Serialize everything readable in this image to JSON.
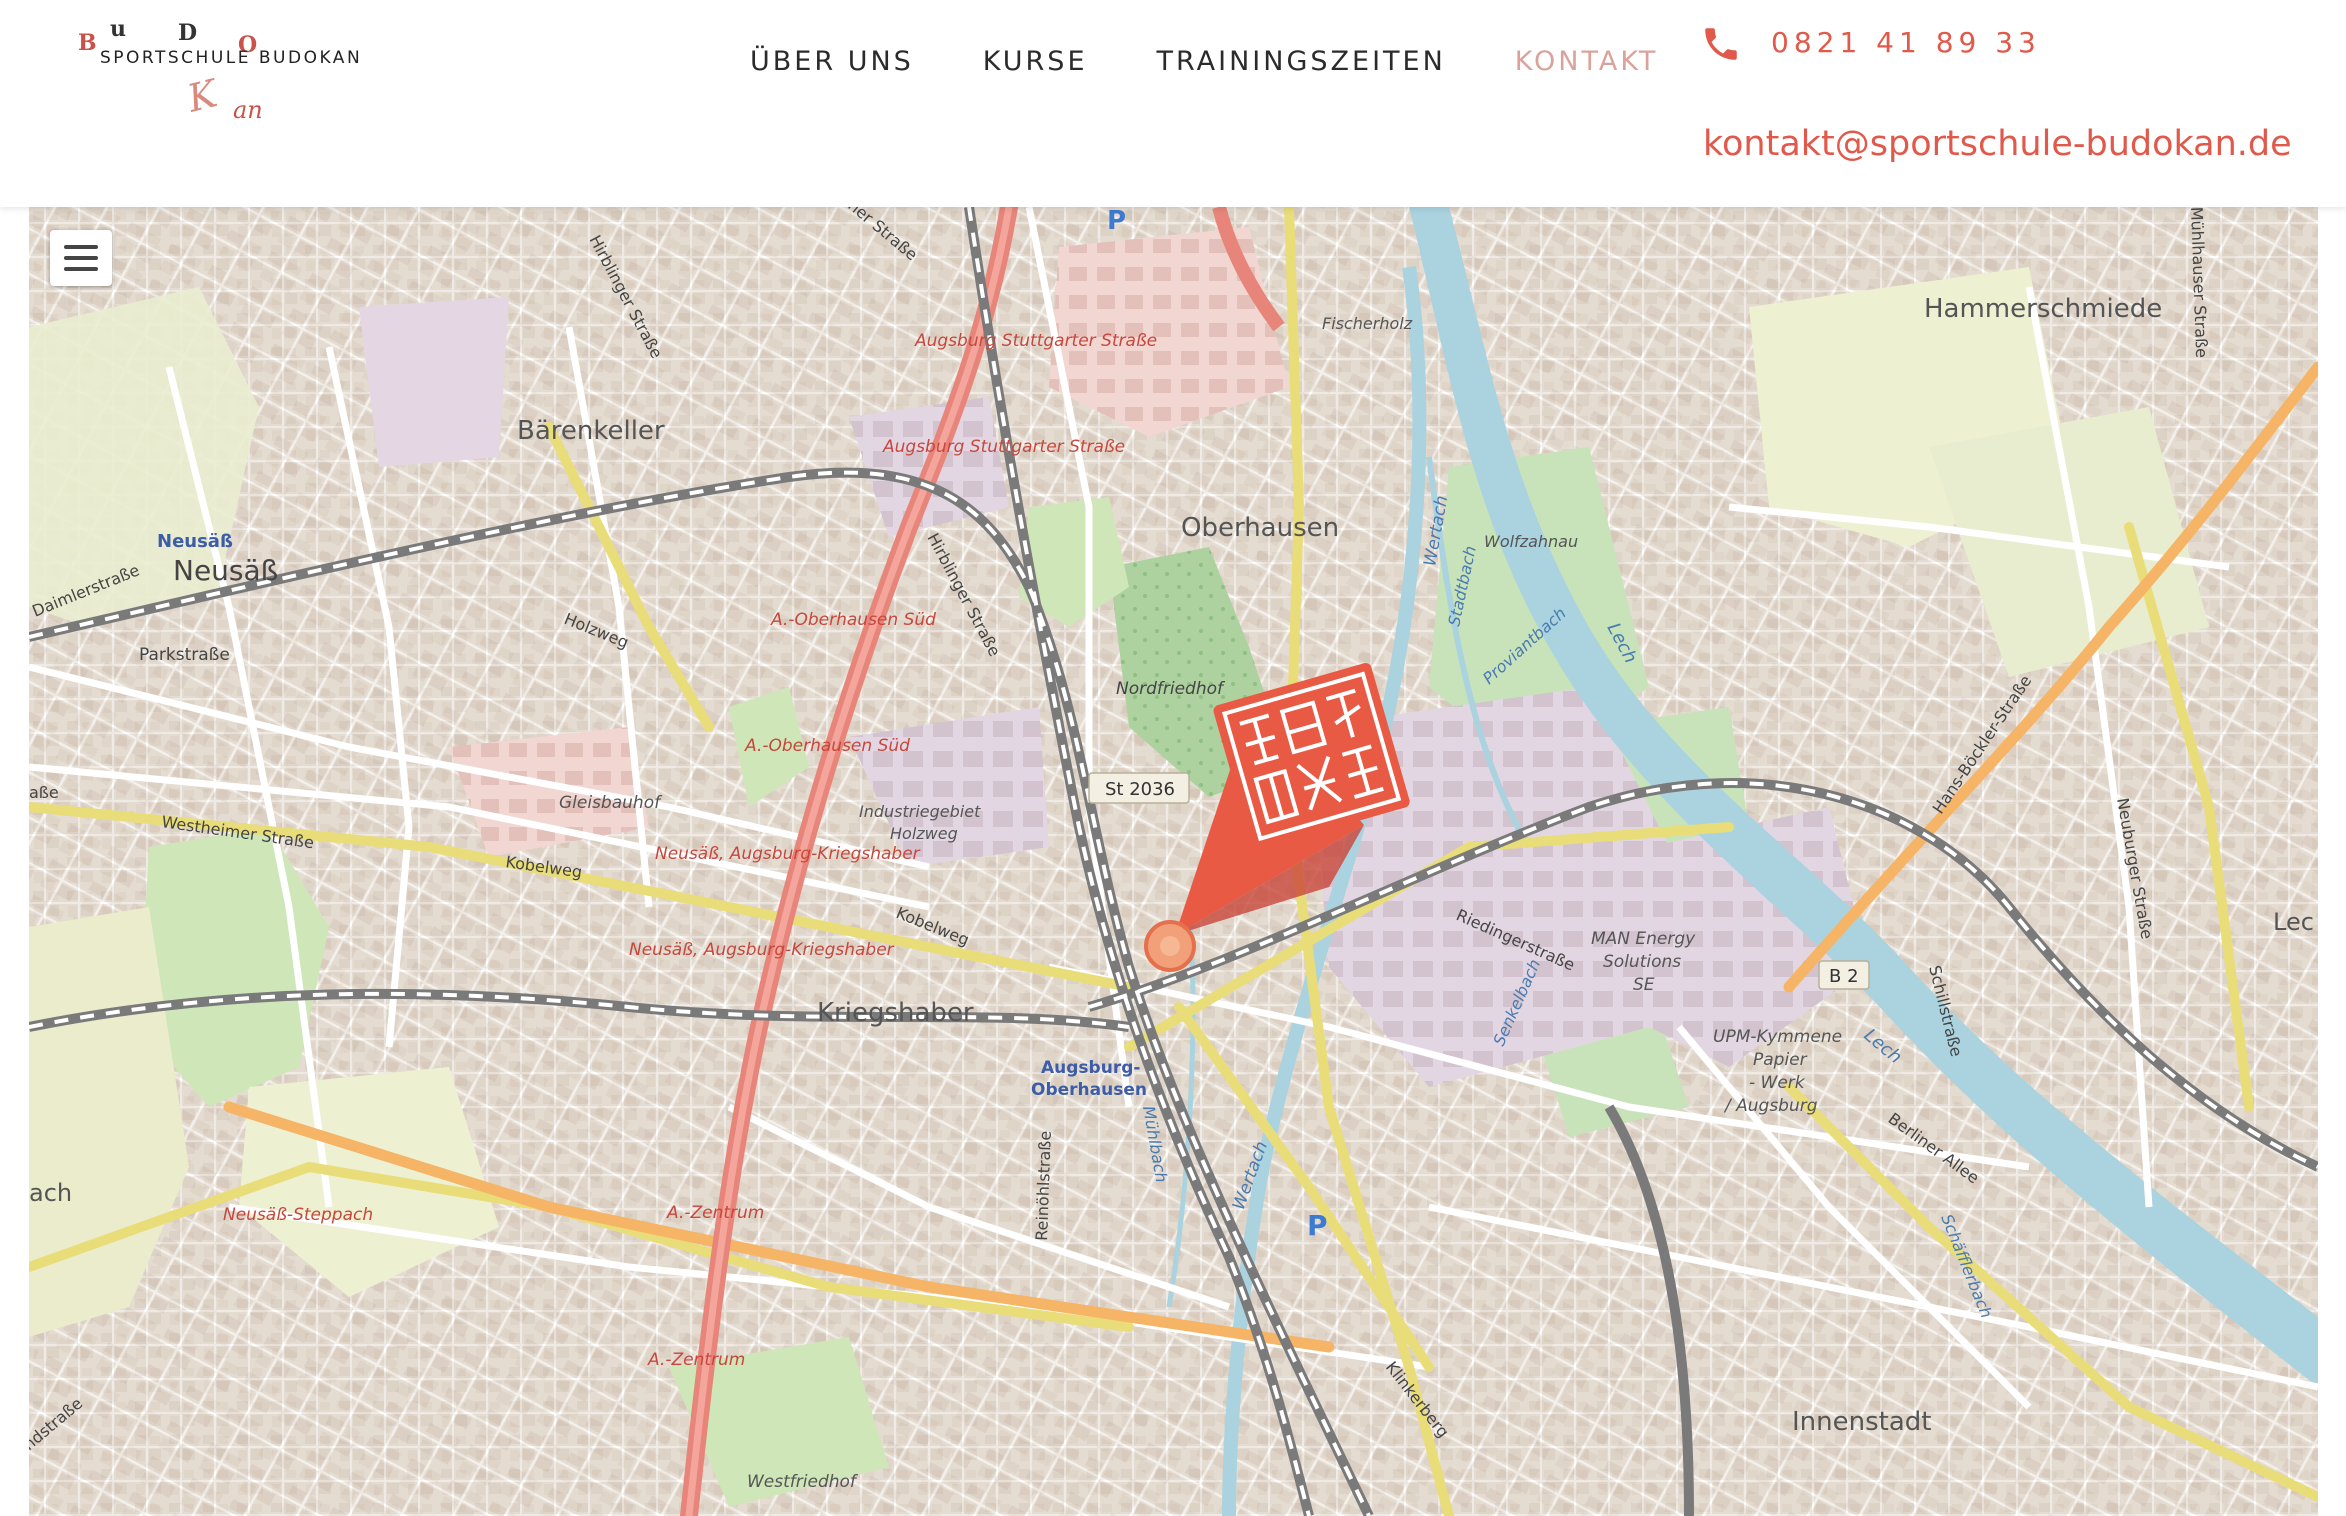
{
  "logo": {
    "letters": [
      "B",
      "u",
      "D",
      "O"
    ],
    "name": "SPORTSCHULE BUDOKAN",
    "kan": "K",
    "an": "an"
  },
  "nav": {
    "items": [
      {
        "label": "ÜBER UNS"
      },
      {
        "label": "KURSE"
      },
      {
        "label": "TRAININGSZEITEN"
      },
      {
        "label": "KONTAKT"
      }
    ]
  },
  "contact": {
    "phone": "0821 41 89 33",
    "email": "kontakt@sportschule-budokan.de",
    "phone_icon": "phone-icon"
  },
  "map": {
    "menu_icon": "hamburger-menu-icon",
    "marker_icon": "budokan-seal-marker-icon",
    "labels": {
      "hammerschmiede": "Hammerschmiede",
      "baerenkeller": "Bärenkeller",
      "oberhausen": "Oberhausen",
      "neusass_blue": "Neusäß",
      "neusass": "Neusäß",
      "parkstrasse": "Parkstraße",
      "daimlerstrasse": "Daimlerstraße",
      "holzweg": "Holzweg",
      "a_oberhausen_sued1": "A.-Oberhausen Süd",
      "a_oberhausen_sued2": "A.-Oberhausen Süd",
      "nordfriedhof": "Nordfriedhof",
      "st2036": "St 2036",
      "gleisbauhof": "Gleisbauhof",
      "industriegebiet": "Industriegebiet",
      "holzweg2": "Holzweg",
      "westheimer": "Westheimer Straße",
      "kobelweg1": "Kobelweg",
      "kobelweg2": "Kobelweg",
      "neusass_kriegshaber1": "Neusäß, Augsburg-Kriegshaber",
      "neusass_kriegshaber2": "Neusäß, Augsburg-Kriegshaber",
      "kriegshaber": "Kriegshaber",
      "augsburg_oberhausen1": "Augsburg-",
      "augsburg_oberhausen2": "Oberhausen",
      "neusass_steppach": "Neusäß-Steppach",
      "a_zentrum1": "A.-Zentrum",
      "a_zentrum2": "A.-Zentrum",
      "westfriedhof": "Westfriedhof",
      "innenstadt": "Innenstadt",
      "wolfzahnau": "Wolfzahnau",
      "fischerholz": "Fischerholz",
      "stuttgarter1": "Augsburg Stuttgarter Straße",
      "stuttgarter2": "Augsburg Stuttgarter Straße",
      "man1": "MAN Energy",
      "man2": "Solutions",
      "man3": "SE",
      "upm1": "UPM-Kymmene",
      "upm2": "Papier",
      "upm3": "- Werk",
      "upm4": "/ Augsburg",
      "riedinger": "Riedingerstraße",
      "b2": "B 2",
      "lech": "Lech",
      "lech2": "Lech",
      "wertach": "Wertach",
      "wertach2": "Wertach",
      "hirblinger1": "Hirblinger Straße",
      "hirblinger2": "Hirblinger Straße",
      "hans_boeckler": "Hans-Böckler-Straße",
      "neuburger": "Neuburger Straße",
      "schillstrasse": "Schillstraße",
      "berliner": "Berliner Allee",
      "reinoehl": "Reinöhlstraße",
      "klinkerberg": "Klinkerberg",
      "senkelbach": "Senkelbach",
      "muehlbach": "Mühlbach",
      "proviantbach": "Proviantbach",
      "stadtbach": "Stadtbach",
      "schaeffler": "Schäfflerbach",
      "muehlhauser": "Mühlhauser Straße",
      "ach": "ach",
      "ndstrasse": "ndstraße",
      "aße": "aße",
      "lec": "Lec",
      "ner_strasse": "ner Straße",
      "parking": "P"
    }
  }
}
